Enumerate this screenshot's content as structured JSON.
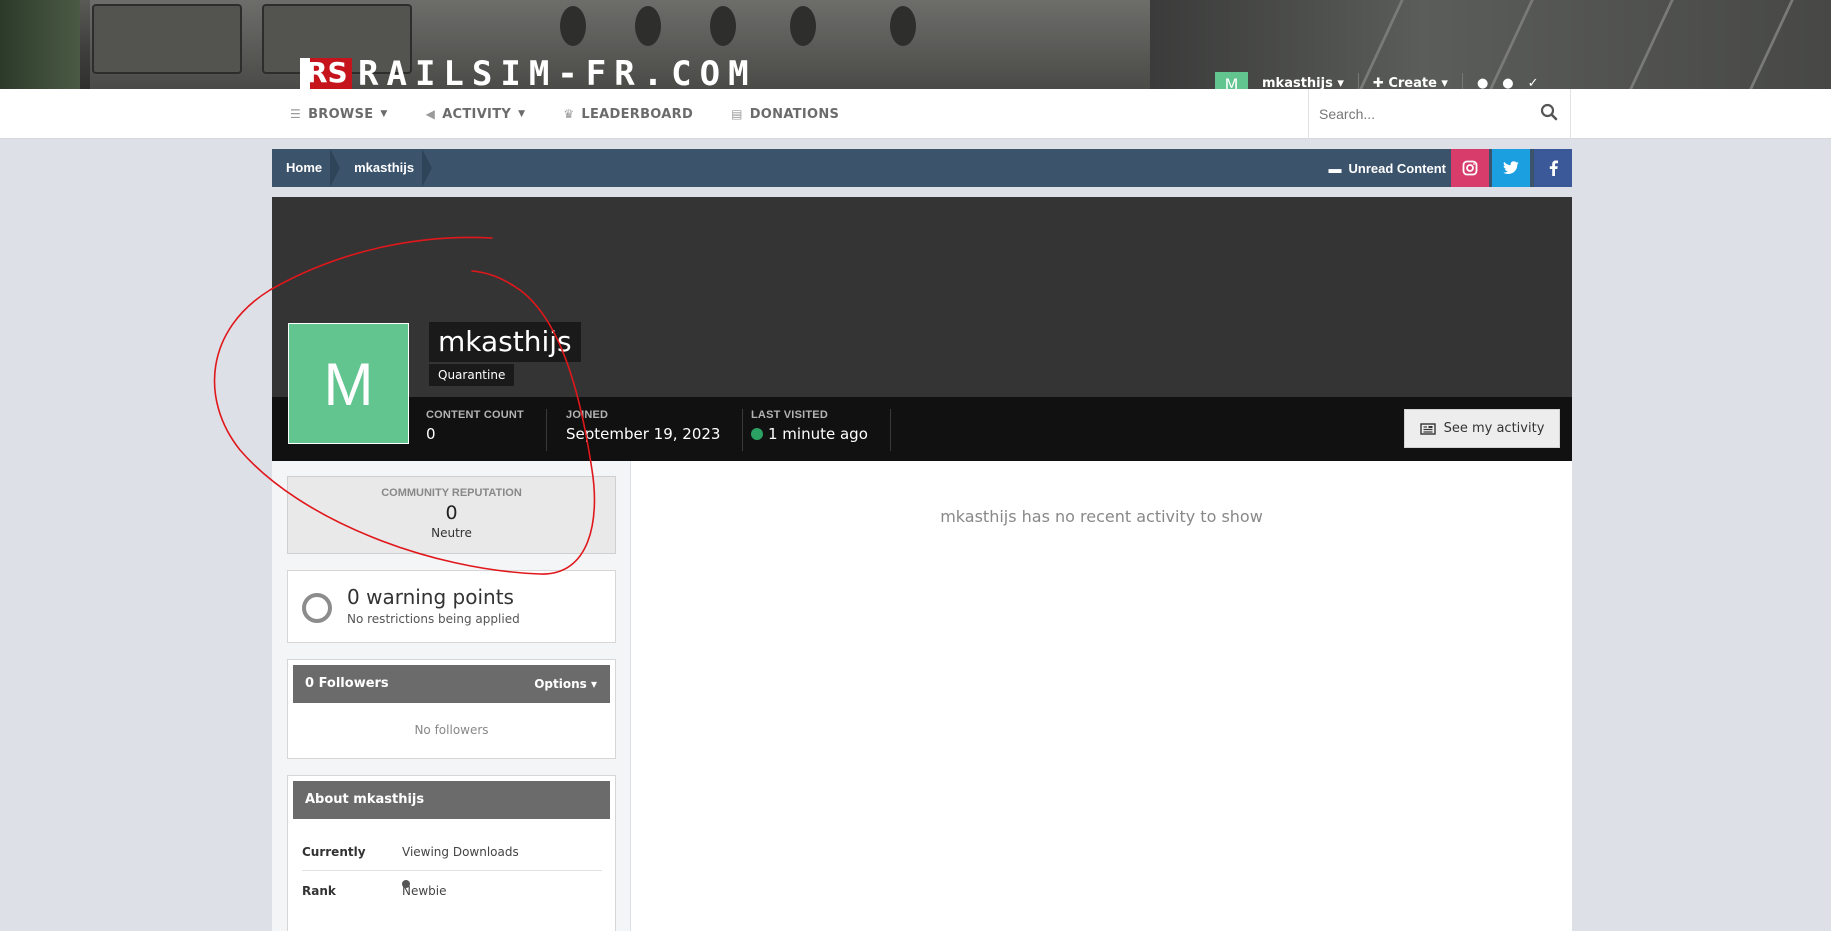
{
  "header": {
    "logo_mark": "RS",
    "logo_text": "RAILSIM-FR.COM",
    "user": {
      "avatar_letter": "M",
      "name": "mkasthijs",
      "create_label": "Create"
    }
  },
  "nav": {
    "items": [
      {
        "label": "BROWSE",
        "icon": "list-icon",
        "has_caret": true
      },
      {
        "label": "ACTIVITY",
        "icon": "megaphone-icon",
        "has_caret": true
      },
      {
        "label": "LEADERBOARD",
        "icon": "trophy-icon",
        "has_caret": false
      },
      {
        "label": "DONATIONS",
        "icon": "document-icon",
        "has_caret": false
      }
    ],
    "search_placeholder": "Search..."
  },
  "breadcrumb": {
    "items": [
      "Home",
      "mkasthijs"
    ],
    "unread_label": "Unread Content",
    "social": [
      "instagram-icon",
      "twitter-icon",
      "facebook-icon"
    ]
  },
  "profile": {
    "avatar_letter": "M",
    "username": "mkasthijs",
    "group": "Quarantine",
    "stats": [
      {
        "label": "CONTENT COUNT",
        "value": "0"
      },
      {
        "label": "JOINED",
        "value": "September 19, 2023"
      },
      {
        "label": "LAST VISITED",
        "value": "1 minute ago"
      }
    ],
    "see_activity_label": "See my activity",
    "online_color": "#2ba163",
    "avatar_color": "#62c48f"
  },
  "sidebar": {
    "reputation": {
      "title": "COMMUNITY REPUTATION",
      "value": "0",
      "label": "Neutre"
    },
    "warnings": {
      "title": "0 warning points",
      "subtitle": "No restrictions being applied"
    },
    "followers": {
      "title": "0 Followers",
      "options_label": "Options",
      "empty": "No followers"
    },
    "about": {
      "title": "About mkasthijs",
      "rows": [
        {
          "key": "Currently",
          "value": "Viewing Downloads"
        },
        {
          "key": "Rank",
          "value": "Newbie"
        }
      ]
    }
  },
  "main": {
    "empty_message": "mkasthijs has no recent activity to show"
  }
}
